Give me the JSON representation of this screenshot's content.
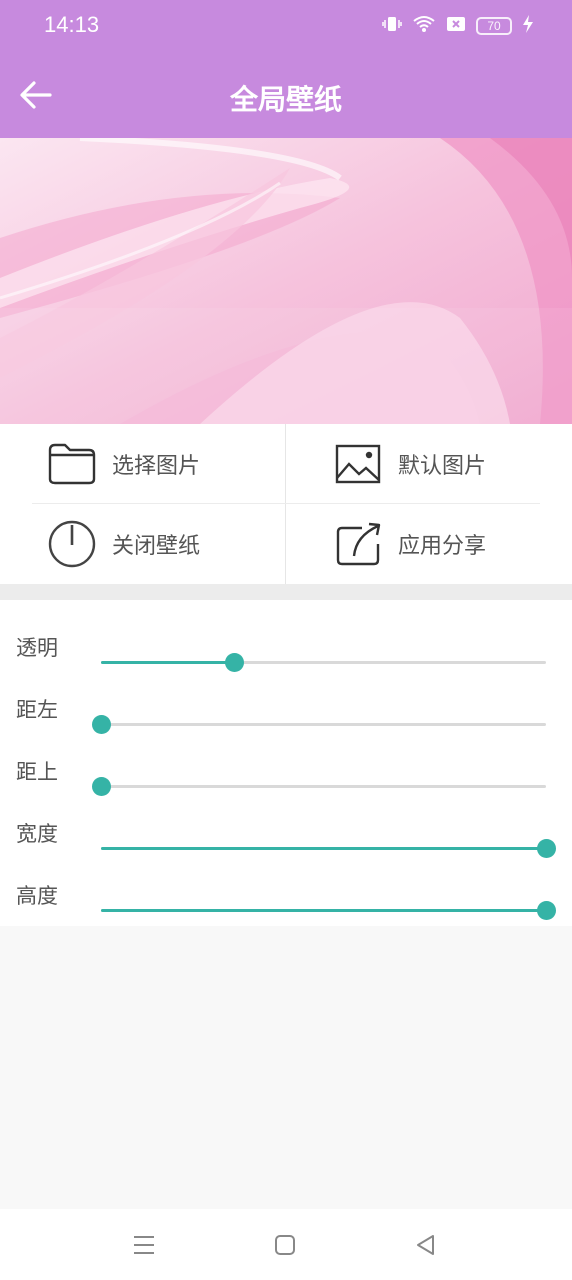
{
  "status": {
    "time": "14:13",
    "battery": "70",
    "icons": [
      "vibrate-icon",
      "wifi-icon",
      "sim-blocked-icon",
      "battery-icon",
      "charging-icon"
    ]
  },
  "appbar": {
    "title": "全局壁纸",
    "back_icon": "arrow-left-icon"
  },
  "actions": [
    {
      "label": "选择图片",
      "icon": "folder-icon"
    },
    {
      "label": "默认图片",
      "icon": "image-icon"
    },
    {
      "label": "关闭壁纸",
      "icon": "power-icon"
    },
    {
      "label": "应用分享",
      "icon": "share-icon"
    }
  ],
  "sliders": [
    {
      "label": "透明",
      "value": 0.3
    },
    {
      "label": "距左",
      "value": 0.0
    },
    {
      "label": "距上",
      "value": 0.0
    },
    {
      "label": "宽度",
      "value": 1.0
    },
    {
      "label": "高度",
      "value": 1.0
    }
  ],
  "colors": {
    "appbar": "#c78ade",
    "accent": "#35b3a6",
    "track": "#d9d9d9"
  },
  "navbar": {
    "icons": [
      "menu-icon",
      "home-icon",
      "back-icon"
    ]
  }
}
